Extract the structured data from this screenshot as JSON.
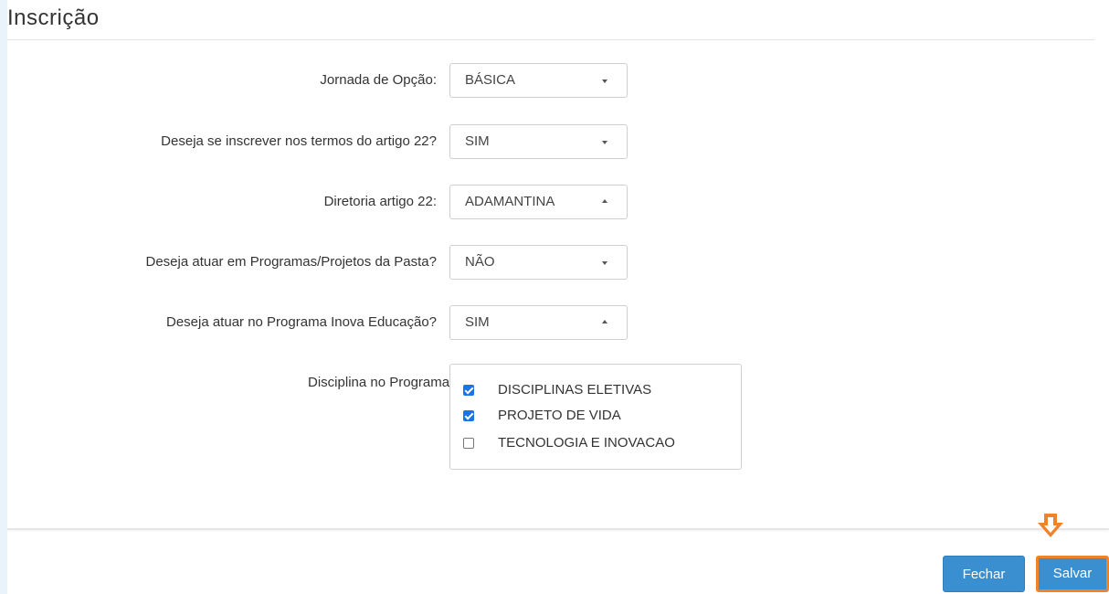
{
  "section": {
    "title": "Inscrição"
  },
  "form": {
    "jornada": {
      "label": "Jornada de Opção:",
      "value": "BÁSICA"
    },
    "artigo22": {
      "label": "Deseja se inscrever nos termos do artigo 22?",
      "value": "SIM"
    },
    "diretoria": {
      "label": "Diretoria artigo 22:",
      "value": "ADAMANTINA"
    },
    "programas": {
      "label": "Deseja atuar em Programas/Projetos da Pasta?",
      "value": "NÃO"
    },
    "inova": {
      "label": "Deseja atuar no Programa Inova Educação?",
      "value": "SIM"
    },
    "disciplina": {
      "label": "Disciplina no Programa Inova Educação:",
      "options": [
        {
          "label": "DISCIPLINAS ELETIVAS",
          "checked": true
        },
        {
          "label": "PROJETO DE VIDA",
          "checked": true
        },
        {
          "label": "TECNOLOGIA E INOVACAO",
          "checked": false
        }
      ]
    }
  },
  "footer": {
    "close_label": "Fechar",
    "save_label": "Salvar"
  },
  "colors": {
    "button_blue": "#3a8fd0",
    "highlight_orange": "#f08228",
    "checkbox_blue": "#1a73e8"
  },
  "icons": {
    "highlight": "arrow-down-icon"
  }
}
